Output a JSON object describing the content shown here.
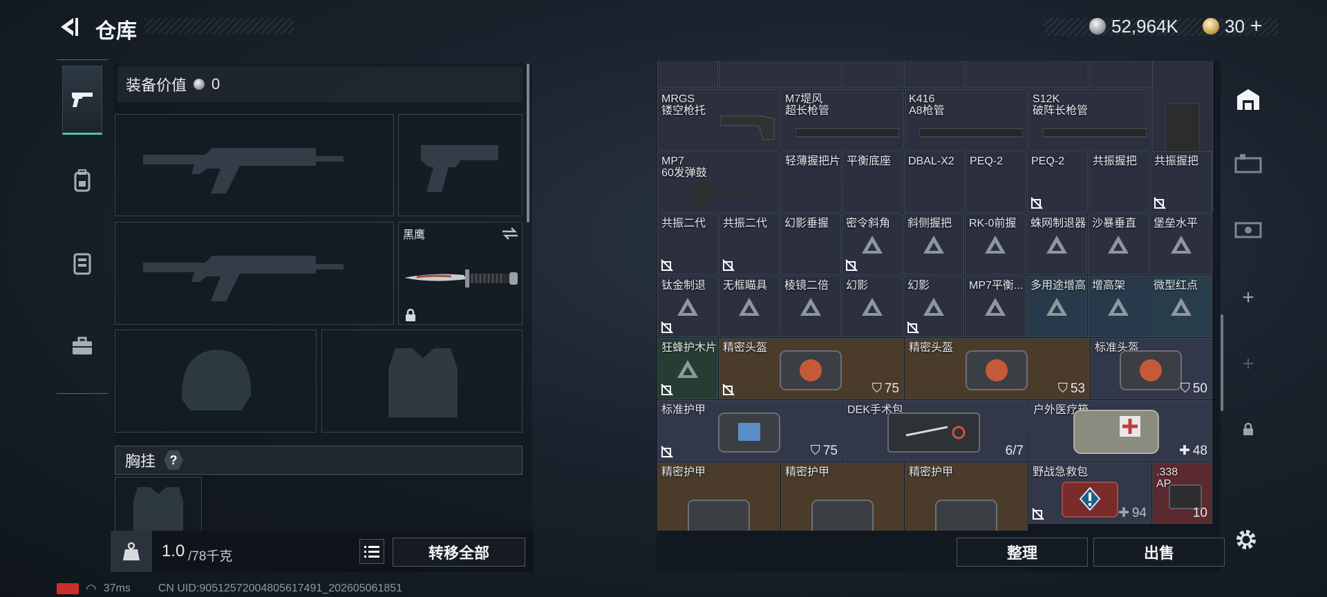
{
  "header": {
    "title": "仓库"
  },
  "currency": {
    "silver": "52,964K",
    "gold": "30",
    "gold_plus": "+"
  },
  "equip": {
    "value_label": "装备价值",
    "value": "0",
    "melee_name": "黑鹰",
    "chest_label": "胸挂",
    "chest_badge": "?"
  },
  "bottom": {
    "weight_current": "1.0",
    "weight_max": "/78千克",
    "transfer_all": "转移全部",
    "organize": "整理",
    "sell": "出售"
  },
  "status": {
    "ping": "37ms",
    "uid": "CN UID:90512572004805617491_202605061851"
  },
  "inventory": {
    "row1": [
      {
        "name": "MRGS\n镂空枪托"
      },
      {
        "name": "M7堤风\n超长枪管"
      },
      {
        "name": "K416\nA8枪管"
      },
      {
        "name": "S12K\n破阵长枪管"
      }
    ],
    "row2": [
      {
        "name": "MP7\n60发弹鼓"
      },
      {
        "name": "轻薄握把片"
      },
      {
        "name": "平衡底座"
      },
      {
        "name": "DBAL-X2"
      },
      {
        "name": "PEQ-2"
      },
      {
        "name": "PEQ-2"
      },
      {
        "name": "共振握把"
      },
      {
        "name": "共振握把"
      }
    ],
    "row3": [
      {
        "name": "共振二代"
      },
      {
        "name": "共振二代"
      },
      {
        "name": "幻影垂握"
      },
      {
        "name": "密令斜角"
      },
      {
        "name": "斜侧握把"
      },
      {
        "name": "RK-0前握"
      },
      {
        "name": "蛛网制退器"
      },
      {
        "name": "沙暴垂直"
      },
      {
        "name": "堡垒水平"
      }
    ],
    "row4": [
      {
        "name": "钛金制退"
      },
      {
        "name": "无框瞄具"
      },
      {
        "name": "棱镜二倍"
      },
      {
        "name": "幻影"
      },
      {
        "name": "幻影"
      },
      {
        "name": "MP7平衡..."
      },
      {
        "name": "多用途增高"
      },
      {
        "name": "增高架"
      },
      {
        "name": "微型红点"
      }
    ],
    "row5": [
      {
        "name": "狂蜂护木片"
      },
      {
        "name": "精密头盔",
        "value": "75"
      },
      {
        "name": "精密头盔",
        "value": "53"
      },
      {
        "name": "标准头盔",
        "value": "50"
      }
    ],
    "row6": [
      {
        "name": "标准护甲",
        "value": "75"
      },
      {
        "name": "DEK手术包",
        "value": "6/7"
      },
      {
        "name": "户外医疗箱",
        "value": "48"
      }
    ],
    "row7": [
      {
        "name": "精密护甲"
      },
      {
        "name": "精密护甲"
      },
      {
        "name": "精密护甲"
      },
      {
        "name": "野战急救包",
        "value": "94"
      },
      {
        "name": ".338\nAP",
        "value": "10"
      }
    ]
  },
  "rail": {
    "add1": "+",
    "add2": "+"
  }
}
